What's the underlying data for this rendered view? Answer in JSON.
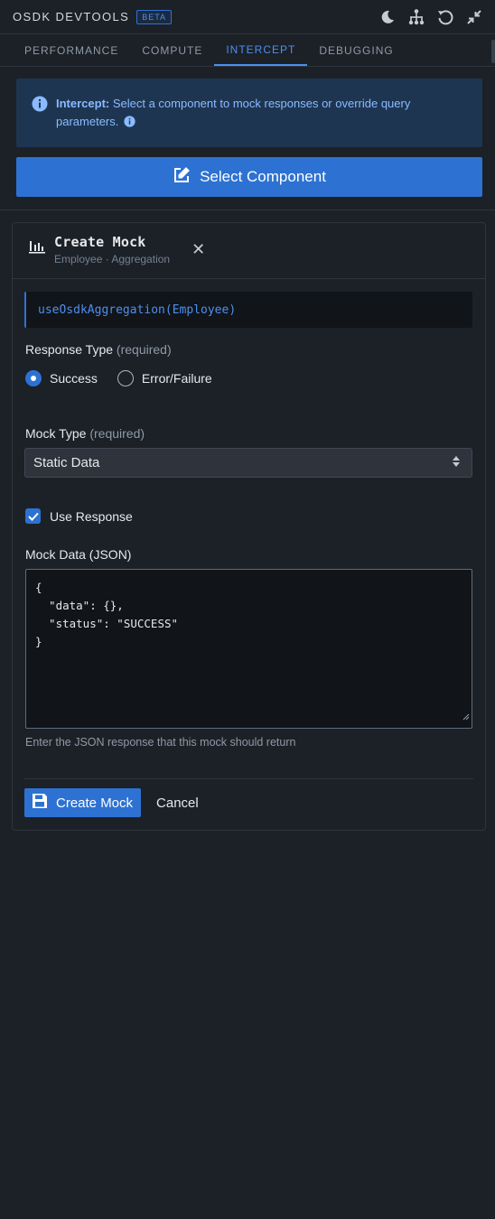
{
  "header": {
    "title": "OSDK DEVTOOLS",
    "badge": "BETA",
    "icons": [
      "moon-icon",
      "hierarchy-icon",
      "refresh-icon",
      "minimize-icon"
    ]
  },
  "tabs": [
    {
      "label": "PERFORMANCE",
      "active": false
    },
    {
      "label": "COMPUTE",
      "active": false
    },
    {
      "label": "INTERCEPT",
      "active": true
    },
    {
      "label": "DEBUGGING",
      "active": false
    }
  ],
  "info": {
    "lead": "Intercept:",
    "text": " Select a component to mock responses or override query parameters."
  },
  "select_component_label": "Select Component",
  "card": {
    "title": "Create Mock",
    "subtitle": "Employee · Aggregation",
    "hook": "useOsdkAggregation(Employee)",
    "response_type": {
      "label": "Response Type",
      "required": "(required)",
      "options": [
        {
          "label": "Success",
          "selected": true
        },
        {
          "label": "Error/Failure",
          "selected": false
        }
      ]
    },
    "mock_type": {
      "label": "Mock Type",
      "required": "(required)",
      "value": "Static Data"
    },
    "use_response": {
      "label": "Use Response",
      "checked": true
    },
    "mock_data": {
      "label": "Mock Data (JSON)",
      "value": "{\n  \"data\": {},\n  \"status\": \"SUCCESS\"\n}",
      "hint": "Enter the JSON response that this mock should return"
    },
    "create_label": "Create Mock",
    "cancel_label": "Cancel"
  },
  "colors": {
    "background": "#1c2127",
    "accent": "#2d72d2",
    "info_bg": "#1e3552",
    "info_text": "#8abbff"
  }
}
